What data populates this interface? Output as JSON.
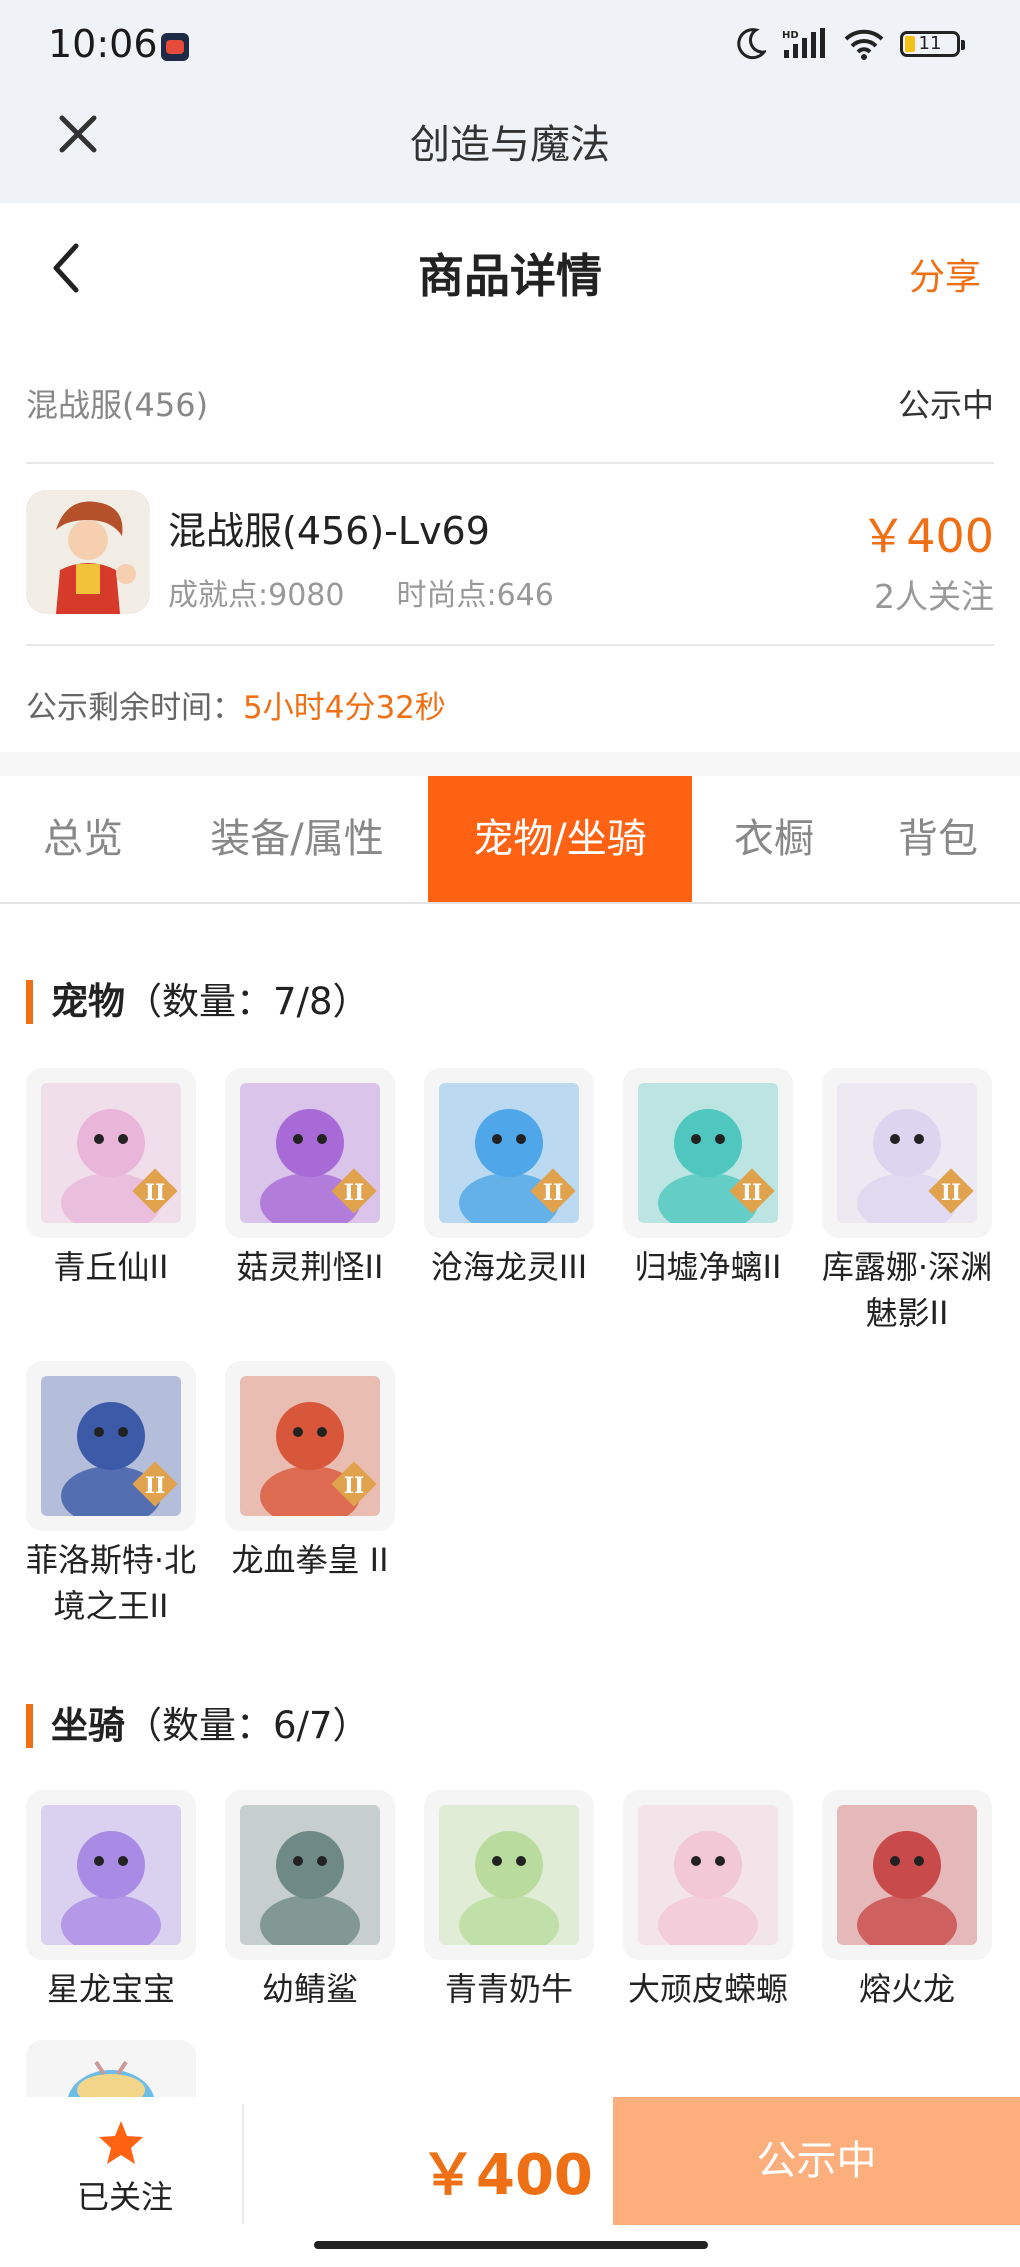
{
  "status_bar": {
    "time": "10:06",
    "battery": "11"
  },
  "app_bar": {
    "title": "创造与魔法"
  },
  "header": {
    "title": "商品详情",
    "share": "分享"
  },
  "listing": {
    "server": "混战服(456)",
    "status": "公示中",
    "character_name": "混战服(456)-Lv69",
    "achievement": "成就点:9080",
    "fashion": "时尚点:646",
    "price": "￥400",
    "watchers": "2人关注",
    "remaining_label": "公示剩余时间：",
    "remaining_value": "5小时4分32秒"
  },
  "tabs": [
    {
      "label": "总览",
      "active": false
    },
    {
      "label": "装备/属性",
      "active": false
    },
    {
      "label": "宠物/坐骑",
      "active": true
    },
    {
      "label": "衣橱",
      "active": false
    },
    {
      "label": "背包",
      "active": false
    }
  ],
  "pets": {
    "title": "宠物",
    "count": "（数量：7/8）",
    "items": [
      {
        "name": "青丘仙II",
        "color": "#e9b6d9"
      },
      {
        "name": "菇灵荆怪II",
        "color": "#a86ad6"
      },
      {
        "name": "沧海龙灵III",
        "color": "#4fa6e8"
      },
      {
        "name": "归墟净螭II",
        "color": "#4fc7bf"
      },
      {
        "name": "库露娜·深渊魅影II",
        "color": "#ddd5ef"
      },
      {
        "name": "菲洛斯特·北境之王II",
        "color": "#3c5aa8"
      },
      {
        "name": "龙血拳皇 II",
        "color": "#d8563a"
      }
    ]
  },
  "mounts": {
    "title": "坐骑",
    "count": "（数量：6/7）",
    "items": [
      {
        "name": "星龙宝宝",
        "color": "#a98be6"
      },
      {
        "name": "幼鲭鲨",
        "color": "#6f8a86"
      },
      {
        "name": "青青奶牛",
        "color": "#b9dc9e"
      },
      {
        "name": "大顽皮蝾螈",
        "color": "#f2c7d6"
      },
      {
        "name": "熔火龙",
        "color": "#c84a4a"
      }
    ]
  },
  "bottom_bar": {
    "follow_label": "已关注",
    "price": "￥400",
    "status_button": "公示中"
  },
  "colors": {
    "accent": "#ef6f14",
    "tab_active": "#ff6213",
    "button_disabled": "#fcae7d"
  }
}
